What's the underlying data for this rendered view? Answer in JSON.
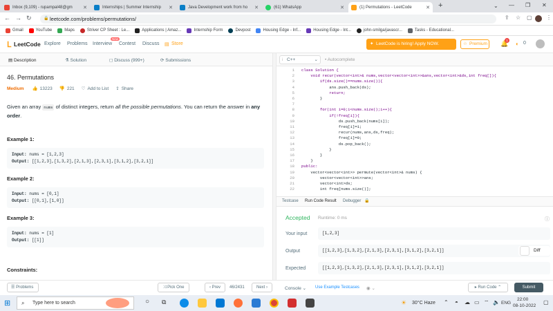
{
  "browser": {
    "tabs": [
      {
        "label": "Inbox (9,109) - rupampal48@gm",
        "color": "#ea4335"
      },
      {
        "label": "Internships | Summer Internship",
        "color": "#0b7fc7"
      },
      {
        "label": "Java Development work from ho",
        "color": "#0b7fc7"
      },
      {
        "label": "(61) WhatsApp",
        "color": "#25d366"
      },
      {
        "label": "(1) Permutations - LeetCode",
        "color": "#ffa116"
      }
    ],
    "new_tab": "+",
    "url": "leetcode.com/problems/permutations/",
    "bookmarks": [
      "Gmail",
      "YouTube",
      "Maps",
      "Striver CP Sheet : Le...",
      "Applications | Amaz...",
      "Internship Form",
      "Devpost",
      "Housing Edge - Inf...",
      "Housing Edge - Int...",
      "john-smilga/javascr...",
      "Tasks - Educational..."
    ]
  },
  "lc": {
    "logo": "LeetCode",
    "nav": [
      "Explore",
      "Problems",
      "Interview",
      "Contest",
      "Discuss",
      "Store"
    ],
    "new_badge": "New",
    "hiring": "LeetCode is hiring! Apply NOW.",
    "premium": "Premium",
    "notif_count": "1",
    "coins": "0"
  },
  "left": {
    "tabs": [
      "Description",
      "Solution",
      "Discuss (999+)",
      "Submissions"
    ],
    "title": "46. Permutations",
    "difficulty": "Medium",
    "likes": "13223",
    "dislikes": "221",
    "add_to_list": "Add to List",
    "share": "Share",
    "desc_pre": "Given an array ",
    "desc_code": "nums",
    "desc_mid": " of distinct integers, return ",
    "desc_em": "all the possible permutations",
    "desc_post": ". You can return the answer in ",
    "desc_bold1": "any",
    "desc_bold2": "order",
    "desc_end": ".",
    "examples": [
      {
        "title": "Example 1:",
        "input": "nums = [1,2,3]",
        "output": "[[1,2,3],[1,3,2],[2,1,3],[2,3,1],[3,1,2],[3,2,1]]"
      },
      {
        "title": "Example 2:",
        "input": "nums = [0,1]",
        "output": "[[0,1],[1,0]]"
      },
      {
        "title": "Example 3:",
        "input": "nums = [1]",
        "output": "[[1]]"
      }
    ],
    "input_label": "Input:",
    "output_label": "Output:",
    "constraints": "Constraints:"
  },
  "editor": {
    "lang": "C++",
    "autocomplete": "Autocomplete",
    "lines": [
      {
        "n": "1",
        "t": "class Solution {"
      },
      {
        "n": "2",
        "t": "    void recur(vector<int>& nums,vector<vector<int>>&ans,vector<int>&ds,int freq[]){"
      },
      {
        "n": "3",
        "t": "        if(ds.size()==nums.size()){"
      },
      {
        "n": "4",
        "t": "            ans.push_back(ds);"
      },
      {
        "n": "5",
        "t": "            return;"
      },
      {
        "n": "6",
        "t": "        }"
      },
      {
        "n": "7",
        "t": ""
      },
      {
        "n": "8",
        "t": "        for(int i=0;i<nums.size();i++){"
      },
      {
        "n": "9",
        "t": "            if(!freq[i]){"
      },
      {
        "n": "10",
        "t": "                ds.push_back(nums[i]);"
      },
      {
        "n": "11",
        "t": "                freq[i]=1;"
      },
      {
        "n": "12",
        "t": "                recur(nums,ans,ds,freq);"
      },
      {
        "n": "13",
        "t": "                freq[i]=0;"
      },
      {
        "n": "14",
        "t": "                ds.pop_back();"
      },
      {
        "n": "15",
        "t": "            }"
      },
      {
        "n": "16",
        "t": "        }"
      },
      {
        "n": "17",
        "t": "    }"
      },
      {
        "n": "18",
        "t": "public:"
      },
      {
        "n": "19",
        "t": "    vector<vector<int>> permute(vector<int>& nums) {"
      },
      {
        "n": "20",
        "t": "        vector<vector<int>>ans;"
      },
      {
        "n": "21",
        "t": "        vector<int>ds;"
      },
      {
        "n": "22",
        "t": "        int freq[nums.size()];"
      }
    ]
  },
  "result": {
    "tabs": [
      "Testcase",
      "Run Code Result",
      "Debugger"
    ],
    "status": "Accepted",
    "runtime": "Runtime: 0 ms",
    "your_input_label": "Your input",
    "your_input": "[1,2,3]",
    "output_label": "Output",
    "output": "[[1,2,3],[1,3,2],[2,1,3],[2,3,1],[3,1,2],[3,2,1]]",
    "diff": "Diff",
    "expected_label": "Expected",
    "expected": "[[1,2,3],[1,3,2],[2,1,3],[2,3,1],[3,1,2],[3,2,1]]"
  },
  "bottom": {
    "problems": "Problems",
    "pick_one": "Pick One",
    "prev": "Prev",
    "page": "46/2431",
    "next": "Next",
    "console": "Console",
    "use_example": "Use Example Testcases",
    "run_code": "Run Code",
    "submit": "Submit"
  },
  "taskbar": {
    "search": "Type here to search",
    "weather": "30°C  Haze",
    "lang": "ENG",
    "time": "22:00",
    "date": "08-10-2022"
  }
}
